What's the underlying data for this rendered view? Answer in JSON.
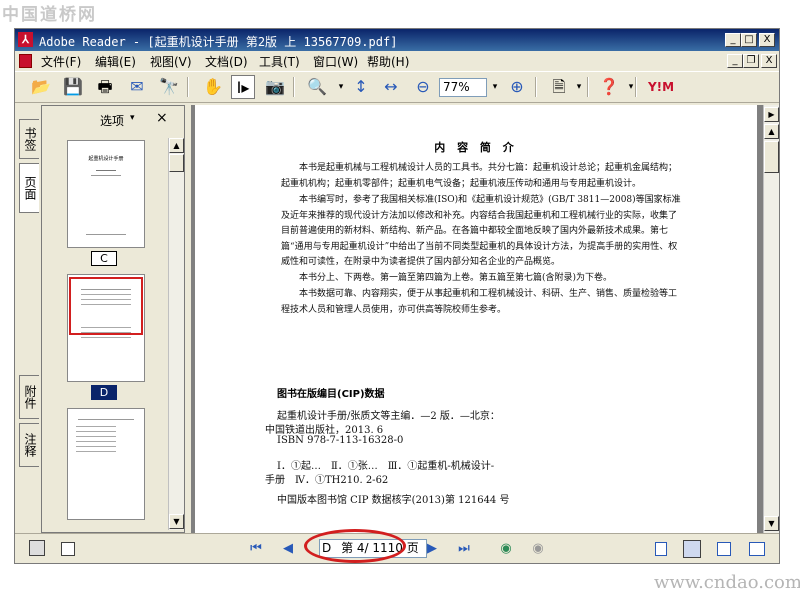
{
  "watermarks": {
    "top": "中国道桥网",
    "bottom": "www.cndao.com"
  },
  "window": {
    "title": "Adobe Reader - [起重机设计手册  第2版  上 13567709.pdf]",
    "controls": {
      "minimize": "_",
      "maximize": "□",
      "close": "X"
    }
  },
  "menu": [
    {
      "label": "文件(F)"
    },
    {
      "label": "编辑(E)"
    },
    {
      "label": "视图(V)"
    },
    {
      "label": "文档(D)"
    },
    {
      "label": "工具(T)"
    },
    {
      "label": "窗口(W)"
    },
    {
      "label": "帮助(H)"
    }
  ],
  "toolbar": {
    "zoom": "77%",
    "icons": [
      "open-icon",
      "save-icon",
      "print-icon",
      "email-icon",
      "search-icon",
      "hand-tool-icon",
      "select-text-icon",
      "snapshot-icon",
      "zoom-in-tool-icon",
      "fit-page-icon",
      "fit-width-icon",
      "zoom-out-icon",
      "zoom-in-icon",
      "rotate-icon",
      "help-icon",
      "yahoo-icon"
    ]
  },
  "nav_panel": {
    "tabs": [
      "书签",
      "页面",
      "附件",
      "注释"
    ],
    "options_label": "选项",
    "close": "×",
    "thumbnails": [
      {
        "label": "C",
        "selected": false,
        "title": "起重机设计手册"
      },
      {
        "label": "D",
        "selected": true
      },
      {
        "label": "",
        "selected": false
      }
    ]
  },
  "document": {
    "heading": "内 容 简 介",
    "paragraphs": [
      "本书是起重机械与工程机械设计人员的工具书。共分七篇：起重机设计总论；起重机金属结构；起重机机构；起重机零部件；起重机电气设备；起重机液压传动和通用与专用起重机设计。",
      "本书编写时，参考了我国相关标准(ISO)和《起重机设计规范》(GB/T 3811—2008)等国家标准及近年来推荐的现代设计方法加以修改和补充。内容结合我国起重机和工程机械行业的实际，收集了目前普遍使用的新材料、新结构、新产品。在各篇中都较全面地反映了国内外最新技术成果。第七篇“通用与专用起重机设计”中给出了当前不同类型起重机的具体设计方法，为提高手册的实用性、权威性和可读性，在附录中为读者提供了国内部分知名企业的产品概览。",
      "本书分上、下两卷。第一篇至第四篇为上卷。第五篇至第七篇(含附录)为下卷。",
      "本书数据可靠、内容翔实，便于从事起重机和工程机械设计、科研、生产、销售、质量检验等工程技术人员和管理人员使用，亦可供高等院校师生参考。"
    ],
    "cip": {
      "heading": "图书在版编目(CIP)数据",
      "lines": [
        "起重机设计手册/张质文等主编．—2 版．—北京：",
        "中国铁道出版社，2013. 6",
        "ISBN 978-7-113-16328-0",
        "Ⅰ．①起…　Ⅱ．①张…　Ⅲ．①起重机-机械设计-",
        "手册　Ⅳ．①TH210. 2-62",
        "中国版本图书馆 CIP 数据核字(2013)第 121644 号"
      ]
    }
  },
  "statusbar": {
    "page_prefix": "D",
    "page_text": "第 4/ 1110 页"
  },
  "colors": {
    "title_bar": "#0a246a",
    "annotation": "#d21f1f",
    "chrome": "#ece9d8"
  }
}
